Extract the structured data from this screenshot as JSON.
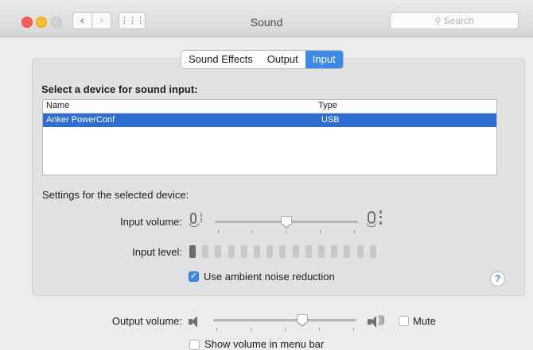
{
  "window": {
    "title": "Sound"
  },
  "search": {
    "placeholder": "Search"
  },
  "tabs": [
    "Sound Effects",
    "Output",
    "Input"
  ],
  "active_tab": "Input",
  "input": {
    "heading": "Select a device for sound input:",
    "columns": {
      "name": "Name",
      "type": "Type"
    },
    "devices": [
      {
        "name": "Anker PowerConf",
        "type": "USB"
      }
    ],
    "settings_label": "Settings for the selected device:",
    "input_volume_label": "Input volume:",
    "input_volume": 0.5,
    "input_level_label": "Input level:",
    "input_level_bars_total": 15,
    "input_level_bars_lit": 1,
    "noise_reduction_label": "Use ambient noise reduction",
    "noise_reduction_checked": true,
    "help": "?"
  },
  "output": {
    "volume_label": "Output volume:",
    "volume": 0.62,
    "mute_label": "Mute",
    "mute_checked": false,
    "show_in_menu_bar_label": "Show volume in menu bar",
    "show_in_menu_bar_checked": false
  },
  "icons": {
    "back": "chevron-left-icon",
    "forward": "chevron-right-icon",
    "grid": "grid-icon",
    "search": "magnifier-icon",
    "mic_low": "microphone-low-icon",
    "mic_high": "microphone-high-icon",
    "speaker_low": "speaker-low-icon",
    "speaker_high": "speaker-high-icon"
  },
  "colors": {
    "accent": "#3d8ae6",
    "selection": "#2e6ed1"
  }
}
